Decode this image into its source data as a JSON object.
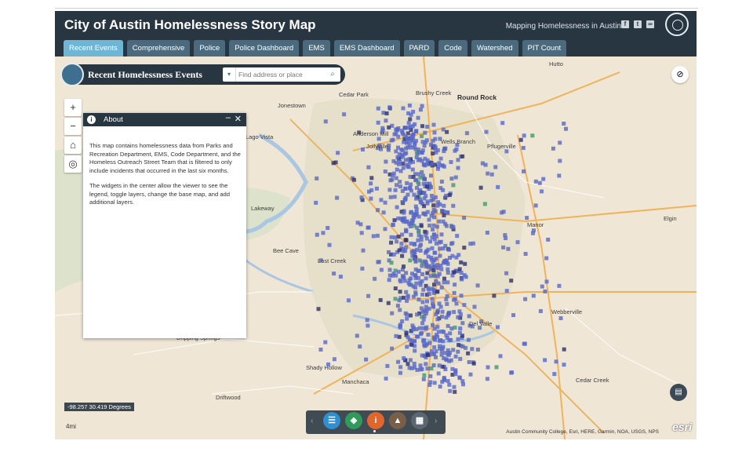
{
  "header": {
    "title": "City of Austin Homelessness Story Map",
    "subtitle": "Mapping Homelessness in Austin",
    "social_icons": [
      "facebook-icon",
      "twitter-icon",
      "link-icon"
    ],
    "background": "#283642"
  },
  "tabs": [
    {
      "label": "Recent Events",
      "active": true
    },
    {
      "label": "Comprehensive",
      "active": false
    },
    {
      "label": "Police",
      "active": false
    },
    {
      "label": "Police Dashboard",
      "active": false
    },
    {
      "label": "EMS",
      "active": false
    },
    {
      "label": "EMS Dashboard",
      "active": false
    },
    {
      "label": "PARD",
      "active": false
    },
    {
      "label": "Code",
      "active": false
    },
    {
      "label": "Watershed",
      "active": false
    },
    {
      "label": "PIT Count",
      "active": false
    }
  ],
  "widget": {
    "title": "Recent Homelessness Events",
    "search_placeholder": "Find address or place"
  },
  "controls": {
    "zoom_in": "+",
    "zoom_out": "−",
    "home_icon": "home-icon",
    "locate_icon": "locate-icon",
    "hide_icon": "eye-slash-icon"
  },
  "about": {
    "title": "About",
    "paragraph1": "This map contains homelessness data from Parks and Recreation Department, EMS, Code Department, and the Homeless Outreach Street Team that is filtered to only include incidents that occurred in the last six months.",
    "paragraph2": "The widgets in the center allow the viewer to see the legend, toggle layers, change the base map, and add additional layers."
  },
  "map": {
    "coordinates": "-98.257 30.419 Degrees",
    "scale": "4mi",
    "attribution": "Austin Community College, Esri, HERE, Garmin, NOA, USGS, NPS",
    "esri_logo": "esri",
    "places": [
      {
        "name": "Hutto",
        "big": false
      },
      {
        "name": "Cedar Park",
        "big": false
      },
      {
        "name": "Brushy Creek",
        "big": false
      },
      {
        "name": "Round Rock",
        "big": true
      },
      {
        "name": "Jonestown",
        "big": false
      },
      {
        "name": "Anderson Mill",
        "big": false
      },
      {
        "name": "Jollyville",
        "big": false
      },
      {
        "name": "Wells Branch",
        "big": false
      },
      {
        "name": "Pflugerville",
        "big": false
      },
      {
        "name": "Lago Vista",
        "big": false
      },
      {
        "name": "Lakeway",
        "big": false
      },
      {
        "name": "Manor",
        "big": false
      },
      {
        "name": "Elgin",
        "big": false
      },
      {
        "name": "Bee Cave",
        "big": false
      },
      {
        "name": "Lost Creek",
        "big": false
      },
      {
        "name": "Webberville",
        "big": false
      },
      {
        "name": "Del Valle",
        "big": false
      },
      {
        "name": "Dripping Springs",
        "big": false
      },
      {
        "name": "Shady Hollow",
        "big": false
      },
      {
        "name": "Manchaca",
        "big": false
      },
      {
        "name": "Driftwood",
        "big": false
      },
      {
        "name": "Cedar Creek",
        "big": false
      }
    ],
    "colors": {
      "incident": "#5868c8",
      "incident_dark": "#2c2f6e",
      "incident_green": "#3f9a6a",
      "water": "#a9c6e2",
      "urban": "#e4ddc7",
      "road": "#f1b35a"
    }
  },
  "toolbar": {
    "buttons": [
      {
        "icon": "legend-icon",
        "color": "#2f8fd0"
      },
      {
        "icon": "layers-icon",
        "color": "#2f9a5a"
      },
      {
        "icon": "info-icon",
        "color": "#e0662d"
      },
      {
        "icon": "basemap-icon",
        "color": "#7a5e48"
      },
      {
        "icon": "grid-icon",
        "color": "#5a6670"
      }
    ],
    "legend_button_icon": "table-icon"
  }
}
